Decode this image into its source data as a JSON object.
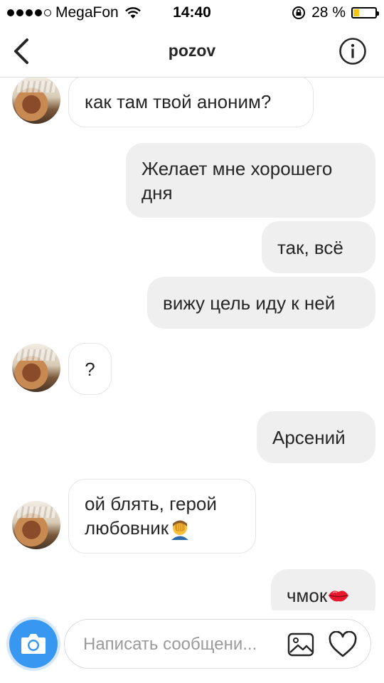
{
  "status_bar": {
    "carrier": "MegaFon",
    "time": "14:40",
    "battery_percent_label": "28 %",
    "battery_level": 0.28,
    "signal_bars_filled": 4,
    "signal_bars_total": 5
  },
  "header": {
    "title": "pozov",
    "back_icon": "chevron-left-icon",
    "info_icon": "info-icon"
  },
  "messages": [
    {
      "direction": "incoming",
      "text": "как там твой аноним?",
      "avatar": true
    },
    {
      "direction": "outgoing",
      "text_lines": [
        "Желает мне хорошего",
        "дня"
      ]
    },
    {
      "direction": "outgoing",
      "text": "так, всё"
    },
    {
      "direction": "outgoing",
      "text": "вижу цель иду к ней"
    },
    {
      "direction": "incoming",
      "text": "?",
      "avatar": true
    },
    {
      "direction": "outgoing",
      "text": "Арсений"
    },
    {
      "direction": "incoming",
      "text_lines": [
        "ой блять, герой",
        "любовник"
      ],
      "emoji": "facepalm-emoji",
      "avatar": true
    },
    {
      "direction": "outgoing",
      "text": "чмок",
      "emoji": "kiss-lips-emoji"
    }
  ],
  "composer": {
    "placeholder": "Написать сообщени...",
    "camera_icon": "camera-icon",
    "gallery_icon": "image-gallery-icon",
    "like_icon": "heart-icon"
  },
  "colors": {
    "accent": "#3897f0",
    "outgoing_bubble": "#efefef",
    "incoming_border": "#e6e6e6",
    "battery_fill": "#f5c518"
  }
}
